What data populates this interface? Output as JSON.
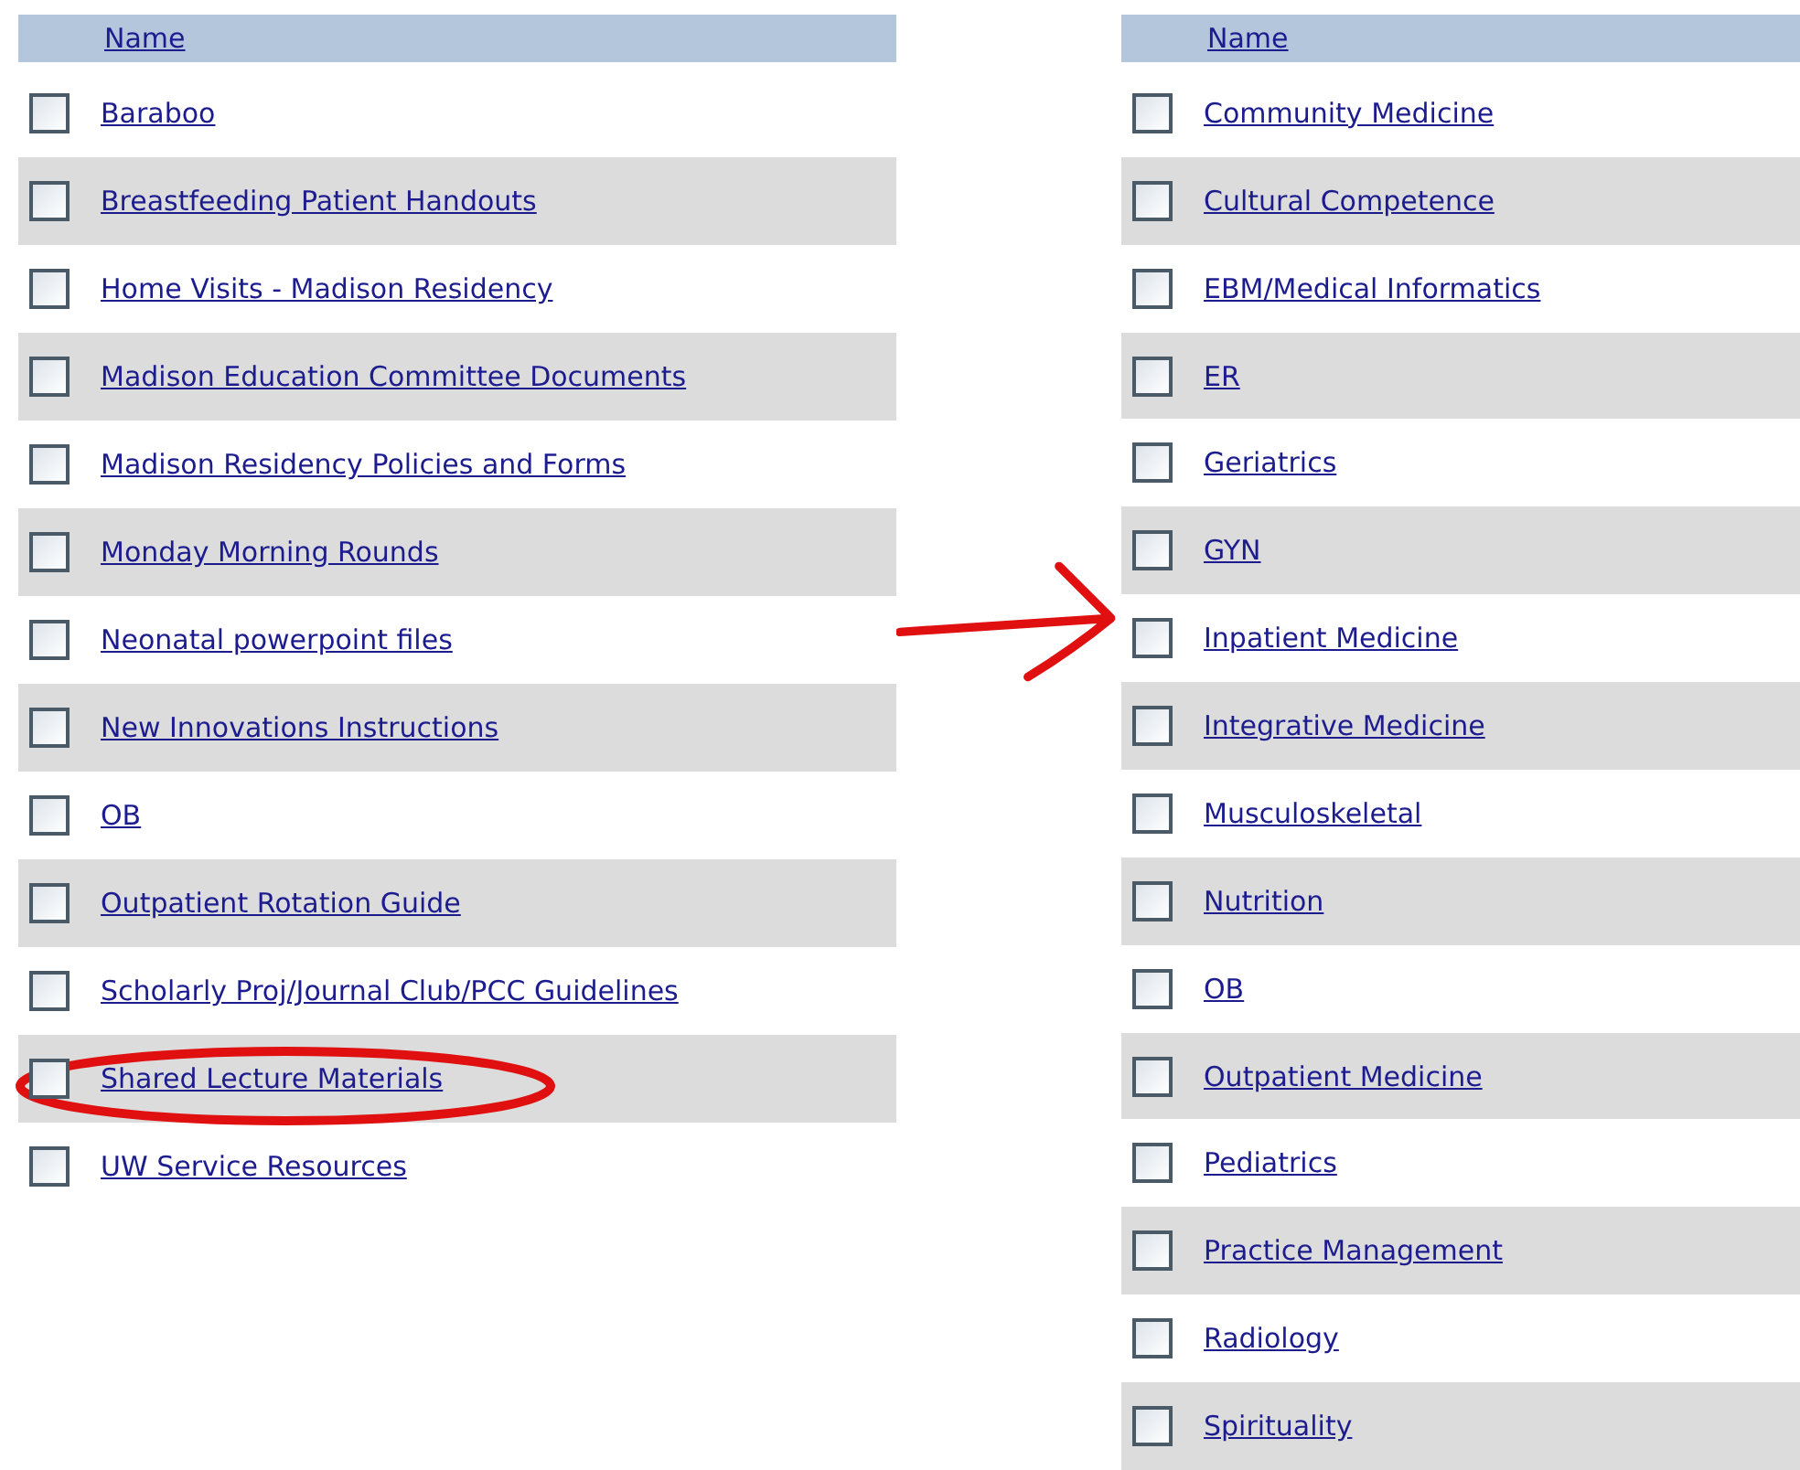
{
  "lists": [
    {
      "header": "Name",
      "items": [
        {
          "label": "Baraboo",
          "checked": false,
          "circled": false
        },
        {
          "label": "Breastfeeding Patient Handouts",
          "checked": false,
          "circled": false
        },
        {
          "label": "Home Visits - Madison Residency",
          "checked": false,
          "circled": false
        },
        {
          "label": "Madison Education Committee Documents",
          "checked": false,
          "circled": false
        },
        {
          "label": "Madison Residency Policies and Forms",
          "checked": false,
          "circled": false
        },
        {
          "label": "Monday Morning Rounds",
          "checked": false,
          "circled": false
        },
        {
          "label": "Neonatal powerpoint files",
          "checked": false,
          "circled": false
        },
        {
          "label": "New Innovations Instructions",
          "checked": false,
          "circled": false
        },
        {
          "label": "OB",
          "checked": false,
          "circled": false
        },
        {
          "label": "Outpatient Rotation Guide",
          "checked": false,
          "circled": false
        },
        {
          "label": "Scholarly Proj/Journal Club/PCC Guidelines",
          "checked": false,
          "circled": false
        },
        {
          "label": "Shared Lecture Materials",
          "checked": false,
          "circled": true
        },
        {
          "label": "UW Service Resources",
          "checked": false,
          "circled": false
        }
      ]
    },
    {
      "header": "Name",
      "items": [
        {
          "label": "Community Medicine",
          "checked": false,
          "circled": false
        },
        {
          "label": "Cultural Competence",
          "checked": false,
          "circled": false
        },
        {
          "label": "EBM/Medical Informatics",
          "checked": false,
          "circled": false
        },
        {
          "label": "ER",
          "checked": false,
          "circled": false
        },
        {
          "label": "Geriatrics",
          "checked": false,
          "circled": false
        },
        {
          "label": "GYN",
          "checked": false,
          "circled": false
        },
        {
          "label": "Inpatient Medicine",
          "checked": false,
          "circled": false
        },
        {
          "label": "Integrative Medicine",
          "checked": false,
          "circled": false
        },
        {
          "label": "Musculoskeletal",
          "checked": false,
          "circled": false
        },
        {
          "label": "Nutrition",
          "checked": false,
          "circled": false
        },
        {
          "label": "OB",
          "checked": false,
          "circled": false
        },
        {
          "label": "Outpatient Medicine",
          "checked": false,
          "circled": false
        },
        {
          "label": "Pediatrics",
          "checked": false,
          "circled": false
        },
        {
          "label": "Practice Management",
          "checked": false,
          "circled": false
        },
        {
          "label": "Radiology",
          "checked": false,
          "circled": false
        },
        {
          "label": "Spirituality",
          "checked": false,
          "circled": false
        }
      ]
    }
  ]
}
